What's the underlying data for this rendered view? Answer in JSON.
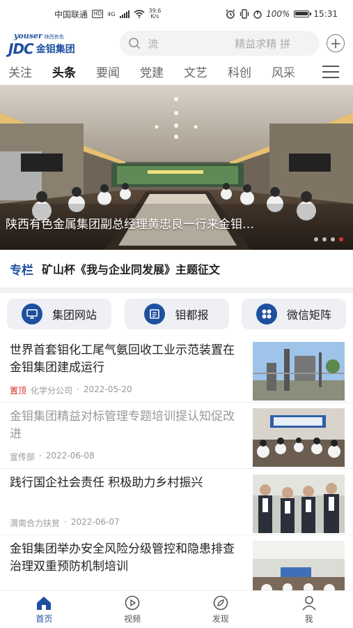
{
  "status": {
    "carrier": "中国联通",
    "hd": "HD",
    "net_type": "4G",
    "speed_value": "39.6",
    "speed_unit": "K/s",
    "battery": "100%",
    "time": "15:31",
    "battery_level": 1.0
  },
  "header": {
    "logo_brand": "youser",
    "logo_brand_cn": "陕西有色",
    "logo_jdc": "JDC",
    "logo_cn": "金钼集团",
    "search_placeholder": "流",
    "search_hint": "精益求精 拼"
  },
  "tabs": [
    "关注",
    "头条",
    "要闻",
    "党建",
    "文艺",
    "科创",
    "风采"
  ],
  "active_tab": "头条",
  "hero": {
    "caption": "陕西有色金属集团副总经理黄忠良一行来金钼…"
  },
  "column": {
    "badge": "专栏",
    "title": "矿山杯《我与企业同发展》主题征文"
  },
  "shortcuts": [
    {
      "label": "集团网站",
      "icon": "monitor-icon"
    },
    {
      "label": "钼都报",
      "icon": "newspaper-icon"
    },
    {
      "label": "微信矩阵",
      "icon": "grid-icon"
    }
  ],
  "news": [
    {
      "title": "世界首套钼化工尾气氨回收工业示范装置在金钼集团建成运行",
      "pin": "置顶",
      "source": "化学分公司",
      "date": "2022-05-20",
      "read": false
    },
    {
      "title": "金钼集团精益对标管理专题培训提认知促改进",
      "pin": "",
      "source": "宣传部",
      "date": "2022-06-08",
      "read": true
    },
    {
      "title": "践行国企社会责任 积极助力乡村振兴",
      "pin": "",
      "source": "渭南合力扶贫",
      "date": "2022-06-07",
      "read": false
    },
    {
      "title": "金钼集团举办安全风险分级管控和隐患排查治理双重预防机制培训",
      "pin": "",
      "source": "",
      "date": "",
      "read": false
    }
  ],
  "bottom_nav": [
    {
      "label": "首页",
      "icon": "home-icon"
    },
    {
      "label": "视频",
      "icon": "play-icon"
    },
    {
      "label": "发现",
      "icon": "compass-icon"
    },
    {
      "label": "我",
      "icon": "person-icon"
    }
  ],
  "colors": {
    "brand": "#1f4fa0",
    "pin": "#d0302a"
  }
}
